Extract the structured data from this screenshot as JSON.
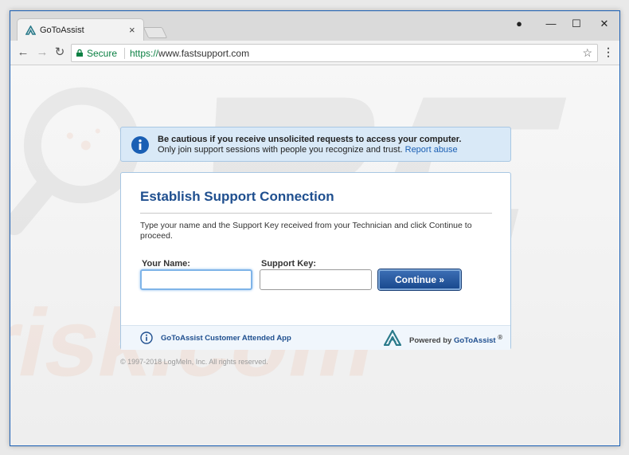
{
  "browser": {
    "tab_title": "GoToAssist",
    "tab_close": "×",
    "secure_label": "Secure",
    "url_protocol": "https://",
    "url_host": "www.fastsupport.com",
    "minimize": "—",
    "maximize": "☐",
    "close": "✕",
    "menu": "⋮",
    "bookmark": "☆",
    "back": "←",
    "forward": "→",
    "reload": "↻",
    "profile": "●"
  },
  "alert": {
    "line1": "Be cautious if you receive unsolicited requests to access your computer.",
    "line2": "Only join support sessions with people you recognize and trust.",
    "link": "Report abuse"
  },
  "panel": {
    "title": "Establish Support Connection",
    "description": "Type your name and the Support Key received from your Technician and click Continue to proceed.",
    "name_label": "Your Name:",
    "name_value": "",
    "key_label": "Support Key:",
    "key_value": "",
    "continue_label": "Continue »"
  },
  "footer": {
    "app_label": "GoToAssist Customer Attended App",
    "powered_by": "Powered by",
    "brand": "GoToAssist",
    "registered": "®"
  },
  "copyright": "© 1997-2018 LogMeIn, Inc. All rights reserved.",
  "colors": {
    "accent": "#1f4f8f",
    "secure_green": "#0b8043",
    "alert_bg": "#d9e9f7"
  }
}
